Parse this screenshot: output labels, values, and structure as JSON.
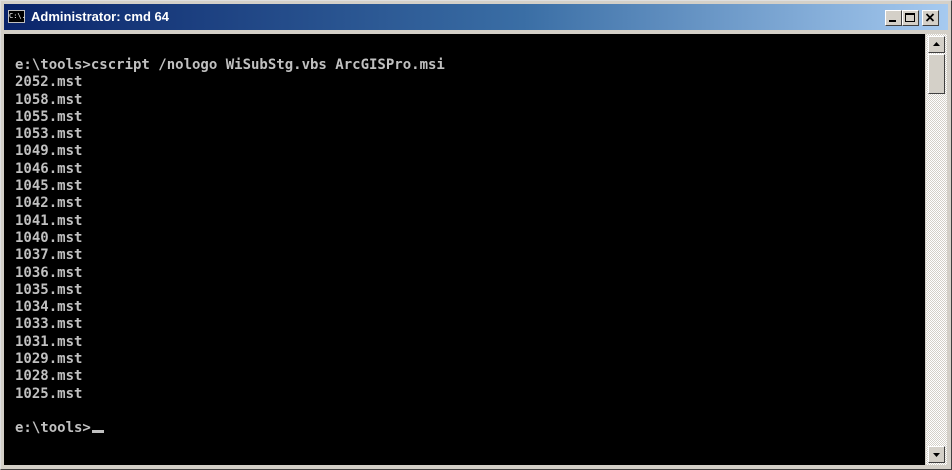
{
  "window": {
    "title": "Administrator: cmd 64",
    "icon_name": "cmd-app-icon",
    "icon_text": "C:\\."
  },
  "console": {
    "lines": [
      "e:\\tools>cscript /nologo WiSubStg.vbs ArcGISPro.msi",
      "2052.mst",
      "1058.mst",
      "1055.mst",
      "1053.mst",
      "1049.mst",
      "1046.mst",
      "1045.mst",
      "1042.mst",
      "1041.mst",
      "1040.mst",
      "1037.mst",
      "1036.mst",
      "1035.mst",
      "1034.mst",
      "1033.mst",
      "1031.mst",
      "1029.mst",
      "1028.mst",
      "1025.mst",
      "",
      "e:\\tools>"
    ],
    "text_color": "#c0c0c0",
    "background": "#000000"
  },
  "colors": {
    "titlebar_start": "#0a246a",
    "titlebar_end": "#a6caf0",
    "chrome": "#d4d0c8"
  }
}
